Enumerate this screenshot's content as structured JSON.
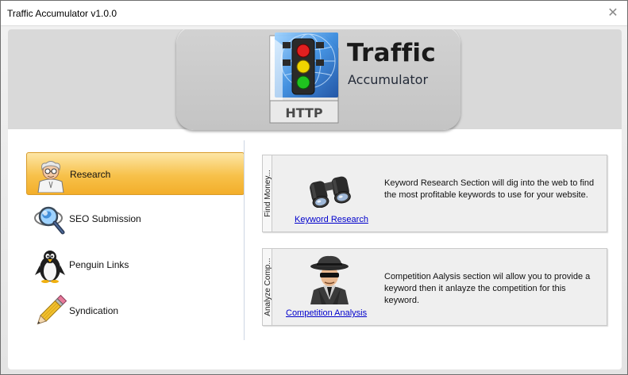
{
  "window": {
    "title": "Traffic Accumulator v1.0.0",
    "close_symbol": "✕"
  },
  "banner": {
    "title": "Traffic",
    "subtitle": "Accumulator",
    "file_label": "HTTP"
  },
  "sidebar": {
    "items": [
      {
        "label": "Research",
        "icon": "scientist-icon",
        "active": true
      },
      {
        "label": "SEO Submission",
        "icon": "magnifier-globe-icon",
        "active": false
      },
      {
        "label": "Penguin Links",
        "icon": "penguin-icon",
        "active": false
      },
      {
        "label": "Syndication",
        "icon": "pencil-icon",
        "active": false
      }
    ]
  },
  "cards": [
    {
      "tab": "Find Money...",
      "link": "Keyword Research",
      "icon": "binoculars-icon",
      "description": "Keyword Research Section will dig into the web to find the most profitable keywords to use for your website."
    },
    {
      "tab": "Analyze Comp...",
      "link": "Competition Analysis",
      "icon": "spy-icon",
      "description": "Competition Aalysis section wil allow you to provide a keyword then it anlayze the competition for this keyword."
    }
  ],
  "colors": {
    "accent": "#f7c14a",
    "banner": "#d9d9d9",
    "link": "#0000cc"
  }
}
